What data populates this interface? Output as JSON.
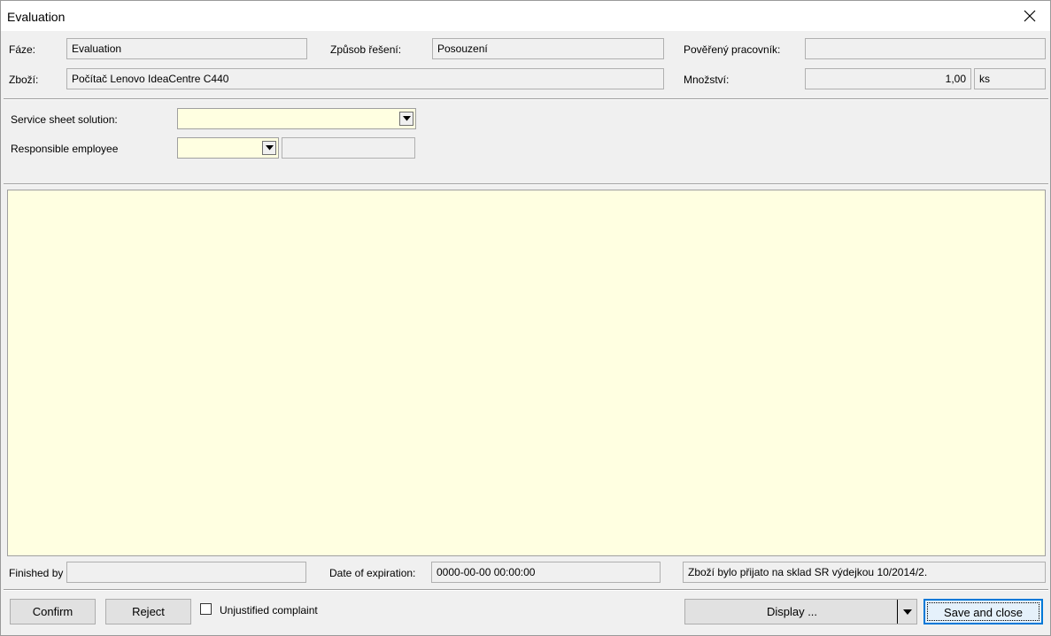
{
  "window": {
    "title": "Evaluation"
  },
  "header": {
    "phase_label": "Fáze:",
    "phase_value": "Evaluation",
    "solution_method_label": "Způsob řešení:",
    "solution_method_value": "Posouzení",
    "assigned_worker_label": "Pověřený pracovník:",
    "assigned_worker_value": "",
    "goods_label": "Zboží:",
    "goods_value": "Počítač Lenovo IdeaCentre C440",
    "quantity_label": "Množství:",
    "quantity_value": "1,00",
    "unit_value": "ks"
  },
  "form": {
    "solution_label": "Service sheet solution:",
    "solution_value": "",
    "employee_label": "Responsible employee",
    "employee_value": "",
    "employee_name": ""
  },
  "memo": {
    "text": ""
  },
  "footer": {
    "finished_by_label": "Finished by",
    "finished_by_value": "",
    "expiration_label": "Date of expiration:",
    "expiration_value": "0000-00-00 00:00:00",
    "status_message": "Zboží bylo přijato na sklad SR výdejkou 10/2014/2."
  },
  "buttons": {
    "confirm": "Confirm",
    "reject": "Reject",
    "unjustified_label": "Unjustified complaint",
    "unjustified_checked": false,
    "display": "Display ...",
    "save_close": "Save and close"
  }
}
